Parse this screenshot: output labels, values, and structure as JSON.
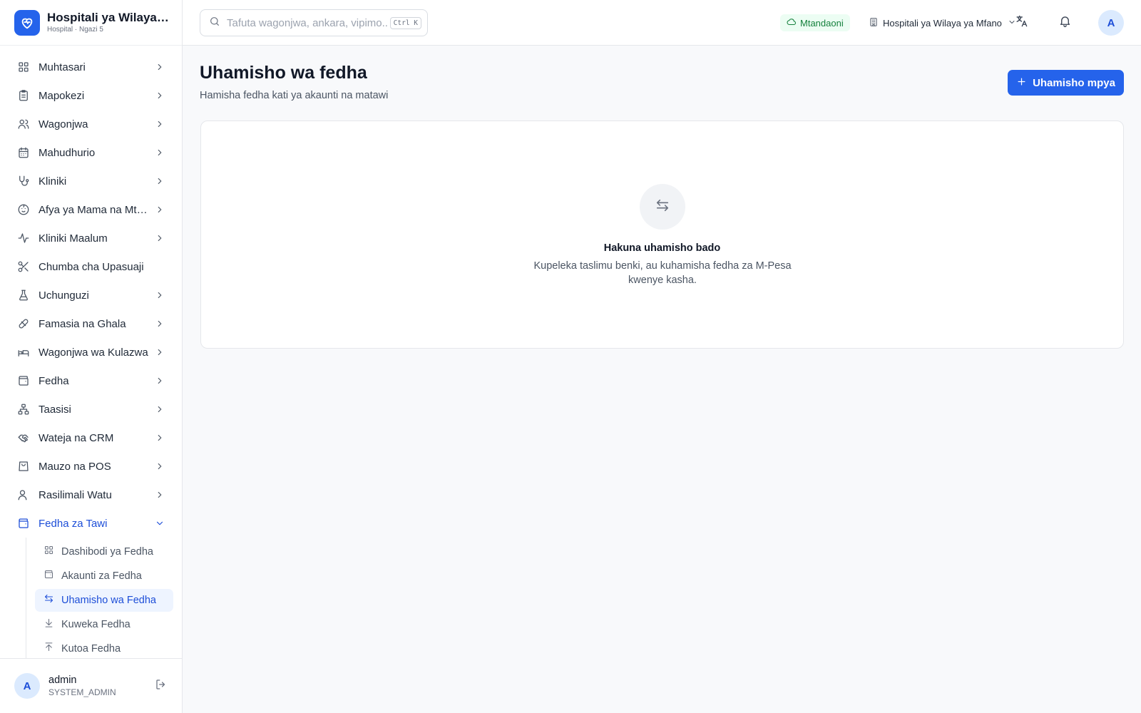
{
  "brand": {
    "title": "Hospitali ya Wilaya ya Mfano",
    "subtitle": "Hospital · Ngazi 5",
    "accent": "#2563eb"
  },
  "sidebar": {
    "items": [
      {
        "label": "Muhtasari",
        "icon": "grid-icon"
      },
      {
        "label": "Mapokezi",
        "icon": "clipboard-icon"
      },
      {
        "label": "Wagonjwa",
        "icon": "users-icon"
      },
      {
        "label": "Mahudhurio",
        "icon": "calendar-icon"
      },
      {
        "label": "Kliniki",
        "icon": "stethoscope-icon"
      },
      {
        "label": "Afya ya Mama na Mtoto",
        "icon": "baby-icon"
      },
      {
        "label": "Kliniki Maalum",
        "icon": "activity-icon"
      },
      {
        "label": "Chumba cha Upasuaji",
        "icon": "scissors-icon"
      },
      {
        "label": "Uchunguzi",
        "icon": "flask-icon"
      },
      {
        "label": "Famasia na Ghala",
        "icon": "pill-icon"
      },
      {
        "label": "Wagonjwa wa Kulazwa",
        "icon": "bed-icon"
      },
      {
        "label": "Fedha",
        "icon": "wallet-icon"
      },
      {
        "label": "Taasisi",
        "icon": "network-icon"
      },
      {
        "label": "Wateja na CRM",
        "icon": "handshake-icon"
      },
      {
        "label": "Mauzo na POS",
        "icon": "shopping-bag-icon"
      },
      {
        "label": "Rasilimali Watu",
        "icon": "user-icon"
      },
      {
        "label": "Fedha za Tawi",
        "icon": "wallet-icon"
      }
    ],
    "sub_items": [
      {
        "label": "Dashibodi ya Fedha",
        "icon": "grid-icon"
      },
      {
        "label": "Akaunti za Fedha",
        "icon": "wallet-icon"
      },
      {
        "label": "Uhamisho wa Fedha",
        "icon": "transfer-icon"
      },
      {
        "label": "Kuweka Fedha",
        "icon": "download-icon"
      },
      {
        "label": "Kutoa Fedha",
        "icon": "upload-icon"
      }
    ]
  },
  "user": {
    "initial": "A",
    "name": "admin",
    "role": "SYSTEM_ADMIN"
  },
  "topbar": {
    "search_placeholder": "Tafuta wagonjwa, ankara, vipimo...",
    "shortcut": "Ctrl K",
    "status": "Mtandaoni",
    "facility": "Hospitali ya Wilaya ya Mfano",
    "avatar_initial": "A"
  },
  "main": {
    "title": "Uhamisho wa fedha",
    "subtitle": "Hamisha fedha kati ya akaunti na matawi",
    "new_button": "Uhamisho mpya",
    "empty_title": "Hakuna uhamisho bado",
    "empty_desc": "Kupeleka taslimu benki, au kuhamisha fedha za M-Pesa kwenye kasha."
  },
  "colors": {
    "primary": "#2563eb",
    "active_text": "#1d4ed8",
    "active_bg": "#eef4ff",
    "online_green": "#15803d"
  }
}
